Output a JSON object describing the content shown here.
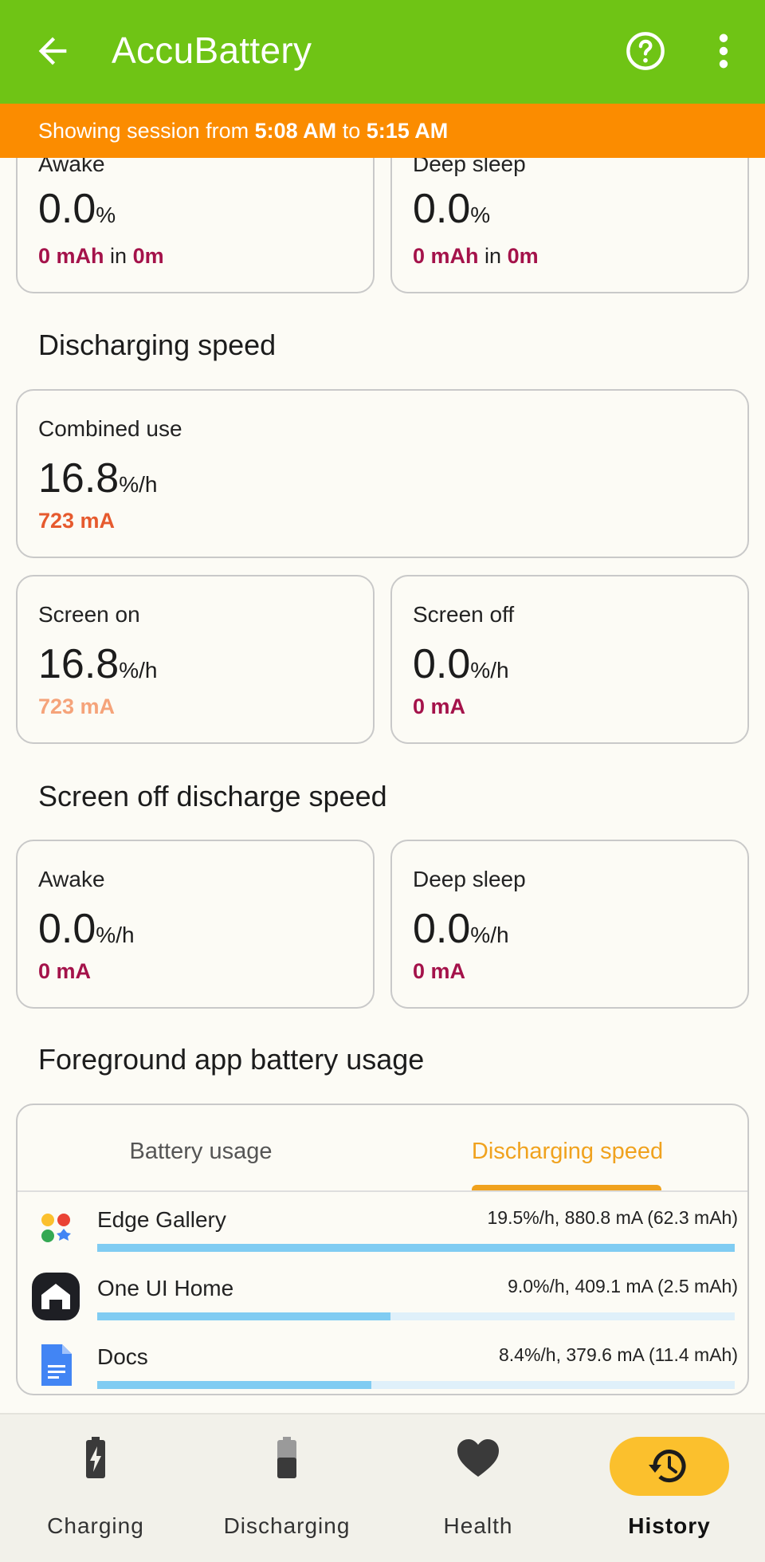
{
  "appbar": {
    "title": "AccuBattery"
  },
  "session": {
    "prefix": "Showing session from",
    "start": "5:08 AM",
    "mid": "to",
    "end": "5:15 AM"
  },
  "top_cards": [
    {
      "label": "Awake",
      "value": "0.0",
      "unit": "%",
      "mah": "0 mAh",
      "in": "in",
      "time": "0m"
    },
    {
      "label": "Deep sleep",
      "value": "0.0",
      "unit": "%",
      "mah": "0 mAh",
      "in": "in",
      "time": "0m"
    }
  ],
  "discharging_speed": {
    "heading": "Discharging speed",
    "combined": {
      "label": "Combined use",
      "value": "16.8",
      "unit": "%/h",
      "current": "723 mA"
    },
    "screen_on": {
      "label": "Screen on",
      "value": "16.8",
      "unit": "%/h",
      "current": "723 mA"
    },
    "screen_off": {
      "label": "Screen off",
      "value": "0.0",
      "unit": "%/h",
      "current": "0 mA"
    }
  },
  "screen_off_speed": {
    "heading": "Screen off discharge speed",
    "awake": {
      "label": "Awake",
      "value": "0.0",
      "unit": "%/h",
      "current": "0 mA"
    },
    "deep_sleep": {
      "label": "Deep sleep",
      "value": "0.0",
      "unit": "%/h",
      "current": "0 mA"
    }
  },
  "foreground": {
    "heading": "Foreground app battery usage",
    "tabs": [
      "Battery usage",
      "Discharging speed"
    ],
    "selected_tab": "Discharging speed",
    "apps": [
      {
        "name": "Edge Gallery",
        "stat": "19.5%/h, 880.8 mA (62.3 mAh)",
        "icon": "edge-gallery-icon",
        "bar_fraction": 1.0
      },
      {
        "name": "One UI Home",
        "stat": "9.0%/h, 409.1 mA (2.5 mAh)",
        "icon": "one-ui-home-icon",
        "bar_fraction": 0.46
      },
      {
        "name": "Docs",
        "stat": "8.4%/h, 379.6 mA (11.4 mAh)",
        "icon": "docs-icon",
        "bar_fraction": 0.43
      }
    ]
  },
  "nav": [
    {
      "label": "Charging",
      "icon": "battery-charging-icon"
    },
    {
      "label": "Discharging",
      "icon": "battery-discharging-icon"
    },
    {
      "label": "Health",
      "icon": "heart-icon"
    },
    {
      "label": "History",
      "icon": "history-icon",
      "active": true
    }
  ],
  "colors": {
    "appbar": "#6fc415",
    "session_banner": "#fb8c00",
    "accent_red": "#a4124a",
    "accent_orange": "#e65a2e",
    "tab_active": "#f0a21e",
    "bar_fill": "#80ccf2",
    "nav_active": "#fbc02d"
  }
}
